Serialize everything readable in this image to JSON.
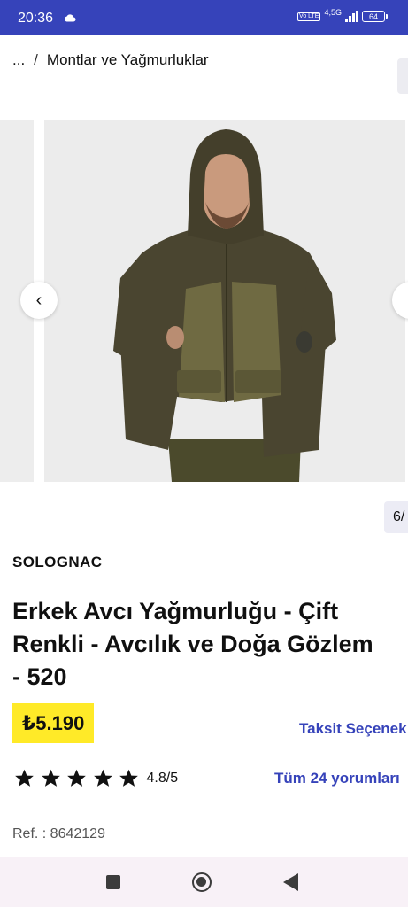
{
  "status_bar": {
    "time": "20:36",
    "network": "4,5G",
    "volte": "Vo LTE",
    "battery": "64",
    "background": "#3643ba"
  },
  "breadcrumb": {
    "ellipsis": "...",
    "separator": "/",
    "current": "Montlar ve Yağmurluklar"
  },
  "gallery": {
    "prev_icon": "‹",
    "next_icon": "›",
    "counter": "6/"
  },
  "product": {
    "brand": "SOLOGNAC",
    "title_lines": [
      "Erkek Avcı Yağmurluğu - Çift",
      "Renkli - Avcılık ve Doğa Gözlem",
      "- 520"
    ],
    "price": "₺5.190",
    "installment_link": "Taksit Seçenek",
    "rating": {
      "value": "4.8/5",
      "stars": 5
    },
    "reviews_link": "Tüm 24 yorumları",
    "reference": "Ref. : 8642129"
  },
  "colors": {
    "accent": "#3643ba",
    "price_highlight": "#ffea28",
    "jacket_dark": "#4a4530",
    "jacket_light": "#6f6a42"
  },
  "icons": [
    "cloud-icon",
    "volte-icon",
    "signal-icon",
    "battery-icon",
    "chevron-left-icon",
    "chevron-right-icon",
    "star-icon",
    "nav-recents-icon",
    "nav-home-icon",
    "nav-back-icon"
  ]
}
